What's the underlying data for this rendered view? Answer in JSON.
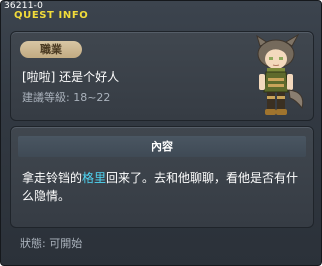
{
  "quest_id": "36211-0",
  "window_title": "QUEST INFO",
  "info": {
    "tag": "職業",
    "npc_name": "[啦啦] 还是个好人",
    "level_range": "建議等級: 18~22"
  },
  "content": {
    "header": "內容",
    "desc_before": "拿走铃铛的",
    "desc_highlight": "格里",
    "desc_after": "回来了。去和他聊聊，看他是否有什么隐情。"
  },
  "status": "狀態: 可開始",
  "colors": {
    "title_yellow": "#f2dc3a",
    "highlight_cyan": "#4fd6f4",
    "tag_beige": "#c9b48e"
  }
}
